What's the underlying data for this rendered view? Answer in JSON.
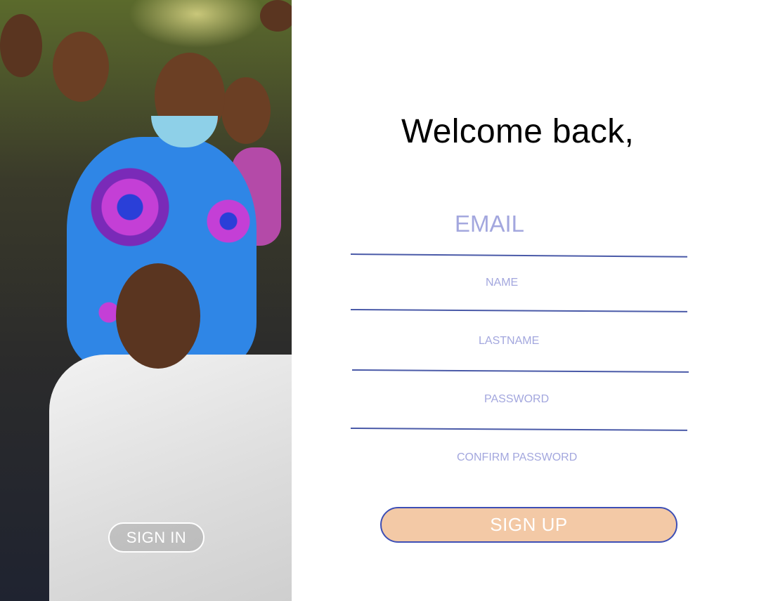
{
  "photo_panel": {
    "signin_label": "SIGN IN"
  },
  "form": {
    "title": "Welcome back,",
    "email_placeholder": "EMAIL",
    "name_placeholder": "NAME",
    "lastname_placeholder": "LASTNAME",
    "password_placeholder": "PASSWORD",
    "confirm_password_placeholder": "CONFIRM PASSWORD",
    "signup_label": "SIGN UP"
  },
  "colors": {
    "accent_line": "#4a5aa8",
    "placeholder_text": "#a3a7de",
    "signup_fill": "#f3c9a6",
    "signup_border": "#3d4fb5"
  }
}
